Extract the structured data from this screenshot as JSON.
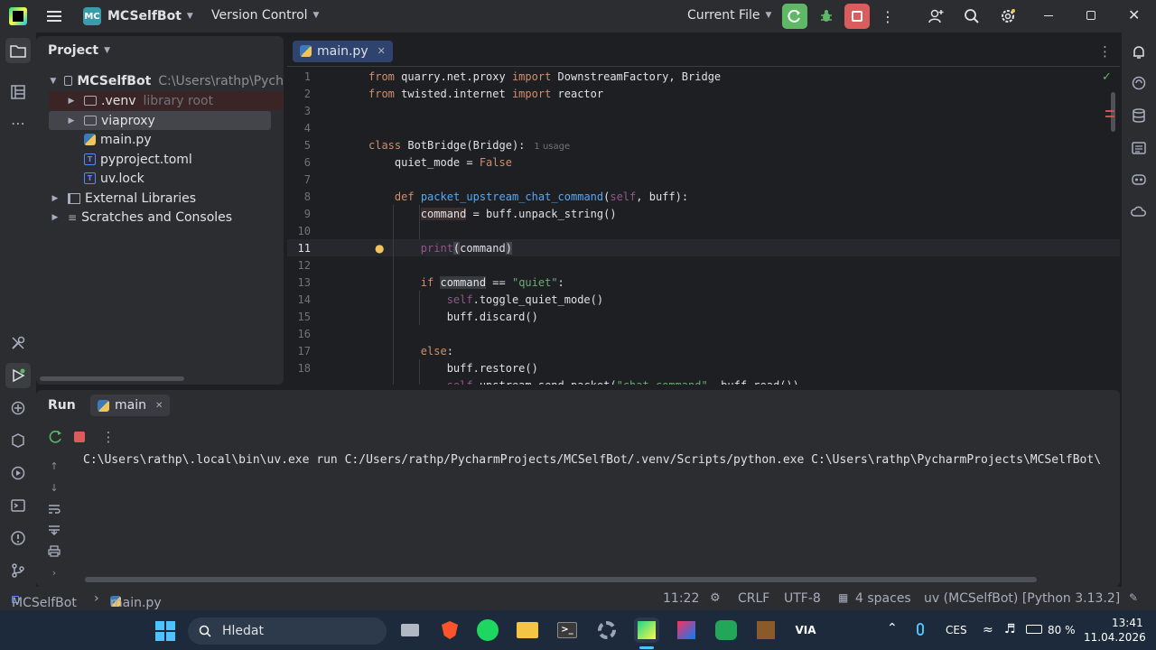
{
  "titlebar": {
    "project_badge": "MC",
    "project_name": "MCSelfBot",
    "vcs_label": "Version Control",
    "run_config": "Current File"
  },
  "project_panel": {
    "title": "Project",
    "tree": [
      {
        "label": "MCSelfBot",
        "hint": "C:\\Users\\rathp\\Pych",
        "type": "root"
      },
      {
        "label": ".venv",
        "hint": "library root",
        "type": "folder"
      },
      {
        "label": "viaproxy",
        "hint": "",
        "type": "folder"
      },
      {
        "label": "main.py",
        "hint": "",
        "type": "python"
      },
      {
        "label": "pyproject.toml",
        "hint": "",
        "type": "toml"
      },
      {
        "label": "uv.lock",
        "hint": "",
        "type": "lock"
      },
      {
        "label": "External Libraries",
        "hint": "",
        "type": "libs"
      },
      {
        "label": "Scratches and Consoles",
        "hint": "",
        "type": "scratch"
      }
    ]
  },
  "editor": {
    "tab_label": "main.py",
    "usage_hint": "1 usage",
    "line_numbers": [
      "1",
      "2",
      "3",
      "4",
      "5",
      "6",
      "7",
      "8",
      "9",
      "10",
      "11",
      "12",
      "13",
      "14",
      "15",
      "16",
      "17",
      "18"
    ]
  },
  "run_panel": {
    "title": "Run",
    "tab_label": "main",
    "output": "C:\\Users\\rathp\\.local\\bin\\uv.exe run C:/Users/rathp/PycharmProjects/MCSelfBot/.venv/Scripts/python.exe C:\\Users\\rathp\\PycharmProjects\\MCSelfBot\\"
  },
  "statusbar": {
    "project": "MCSelfBot",
    "file": "main.py",
    "position": "11:22",
    "line_sep": "CRLF",
    "encoding": "UTF-8",
    "indent": "4 spaces",
    "interpreter": "uv (MCSelfBot) [Python 3.13.2]"
  },
  "taskbar": {
    "search_placeholder": "Hledat",
    "language": "CES",
    "battery": "80 %",
    "time": "13:41",
    "date": "11.04.2026"
  },
  "colors": {
    "accent": "#3574f0",
    "run_green": "#5fb865",
    "stop_red": "#db5c5c"
  }
}
